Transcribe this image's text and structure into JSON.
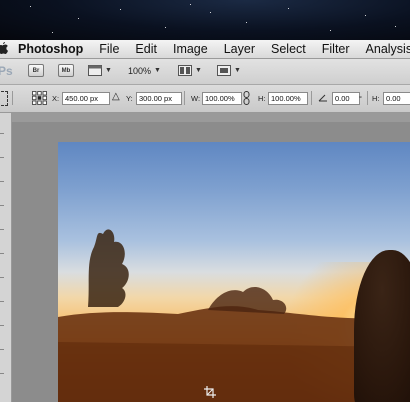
{
  "menubar": {
    "apple_icon": "apple-icon",
    "app_name": "Photoshop",
    "items": [
      "File",
      "Edit",
      "Image",
      "Layer",
      "Select",
      "Filter",
      "Analysis"
    ]
  },
  "appbar": {
    "ps_badge": "Ps",
    "bridge_label": "Br",
    "minibridge_label": "Mb",
    "zoom_value": "100%"
  },
  "options": {
    "x_label": "X:",
    "x_value": "450.00 px",
    "y_label": "Y:",
    "y_value": "300.00 px",
    "w_label": "W:",
    "w_value": "100.00%",
    "h_label": "H:",
    "h_value": "100.00%",
    "angle_value": "0.00",
    "degree_symbol": "°",
    "h2_label": "H:",
    "h2_value": "0.00"
  },
  "colors": {
    "menubar_bg": "#e6e6e6",
    "optbar_bg": "#d2d2d2",
    "workspace_bg": "#8c8c8c"
  }
}
